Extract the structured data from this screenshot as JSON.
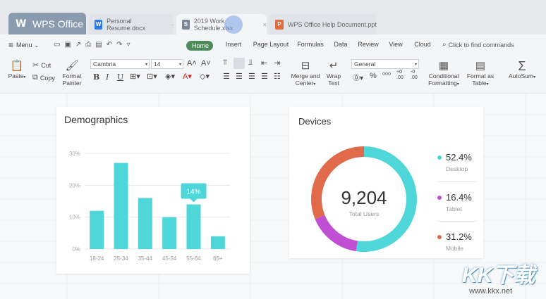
{
  "window": {
    "app_tab": "WPS Office",
    "tabs": [
      {
        "label": "Personal Resume.docx",
        "icon": "W",
        "color": "#2f7be8"
      },
      {
        "label": "2019 Work Schedule.xlsx",
        "icon": "S",
        "color": "#7b8796"
      },
      {
        "label": "WPS Office Help Document.ppt",
        "icon": "P",
        "color": "#e26b3c"
      }
    ]
  },
  "menubar": {
    "menu_label": "Menu",
    "tabs": [
      "Home",
      "Insert",
      "Page Layout",
      "Formulas",
      "Data",
      "Review",
      "View",
      "Cloud"
    ],
    "search_placeholder": "Click to find commands"
  },
  "ribbon": {
    "paste": "Paste",
    "cut": "Cut",
    "copy": "Copy",
    "format_painter": [
      "Format",
      "Painter"
    ],
    "font_name": "Cambria",
    "font_size": "14",
    "merge": [
      "Merge and",
      "Center"
    ],
    "wrap": [
      "Wrap",
      "Text"
    ],
    "number_format": "General",
    "conditional": [
      "Conditional",
      "Formatting"
    ],
    "format_table": [
      "Format as",
      "Table"
    ],
    "autosum": "AutoSum"
  },
  "demographics": {
    "title": "Demographics",
    "tooltip": "14%",
    "chart_data": {
      "type": "bar",
      "categories": [
        "18-24",
        "25-34",
        "35-44",
        "45-54",
        "55-64",
        "65+"
      ],
      "values": [
        12,
        27,
        16,
        10,
        14,
        4
      ],
      "ylim": [
        0,
        30
      ],
      "yticks": [
        "0%",
        "10%",
        "20%",
        "30%"
      ],
      "color": "#4fd6d8"
    }
  },
  "devices": {
    "title": "Devices",
    "total": "9,204",
    "total_label": "Total Users",
    "chart_data": {
      "type": "pie",
      "slices": [
        {
          "name": "Desktop",
          "value": 52.4,
          "label": "52.4%",
          "color": "#4fd6d8"
        },
        {
          "name": "Tablet",
          "value": 16.4,
          "label": "16.4%",
          "color": "#c04fd4"
        },
        {
          "name": "Mobile",
          "value": 31.2,
          "label": "31.2%",
          "color": "#e06a4a"
        }
      ]
    }
  },
  "watermark": {
    "text": "KK下载",
    "url": "www.kkx.net"
  }
}
